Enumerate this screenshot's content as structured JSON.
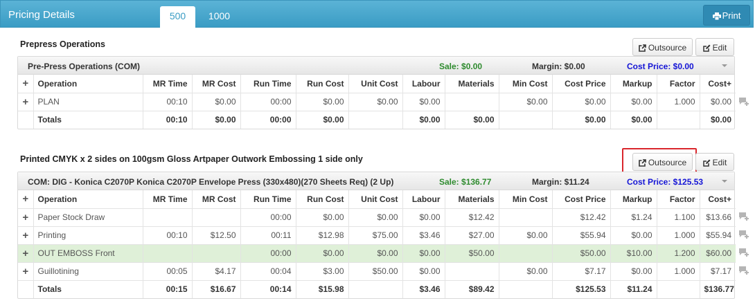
{
  "header": {
    "title": "Pricing Details",
    "tabs": [
      "500",
      "1000"
    ],
    "print_label": "Print"
  },
  "columns": [
    "Operation",
    "MR Time",
    "MR Cost",
    "Run Time",
    "Run Cost",
    "Unit Cost",
    "Labour",
    "Materials",
    "Min Cost",
    "Cost Price",
    "Markup",
    "Factor",
    "Cost+"
  ],
  "sections": [
    {
      "title": "Prepress Operations",
      "outsource_label": "Outsource",
      "edit_label": "Edit",
      "summary": {
        "name": "Pre-Press Operations (COM)",
        "sale": "Sale: $0.00",
        "margin": "Margin: $0.00",
        "cost_price": "Cost Price: $0.00"
      },
      "rows": [
        [
          "PLAN",
          "00:10",
          "$0.00",
          "00:00",
          "$0.00",
          "$0.00",
          "$0.00",
          "",
          "$0.00",
          "$0.00",
          "$0.00",
          "1.000",
          "$0.00"
        ]
      ],
      "totals": [
        "Totals",
        "00:10",
        "$0.00",
        "00:00",
        "$0.00",
        "",
        "$0.00",
        "$0.00",
        "",
        "$0.00",
        "$0.00",
        "",
        "$0.00"
      ]
    },
    {
      "title": "Printed CMYK x 2 sides on 100gsm Gloss Artpaper Outwork Embossing 1 side only",
      "outsource_label": "Outsource",
      "edit_label": "Edit",
      "summary": {
        "name": "COM: DIG - Konica C2070P Konica C2070P Envelope Press (330x480)(270 Sheets Req) (2 Up)",
        "sale": "Sale: $136.77",
        "margin": "Margin: $11.24",
        "cost_price": "Cost Price: $125.53"
      },
      "rows": [
        [
          "Paper Stock Draw",
          "",
          "",
          "00:00",
          "$0.00",
          "$0.00",
          "$0.00",
          "$12.42",
          "",
          "$12.42",
          "$1.24",
          "1.100",
          "$13.66"
        ],
        [
          "Printing",
          "00:10",
          "$12.50",
          "00:11",
          "$12.98",
          "$75.00",
          "$3.46",
          "$27.00",
          "$0.00",
          "$55.94",
          "$0.00",
          "1.000",
          "$55.94"
        ],
        [
          "OUT EMBOSS Front",
          "",
          "",
          "00:00",
          "$0.00",
          "$0.00",
          "$0.00",
          "$50.00",
          "",
          "$50.00",
          "$10.00",
          "1.200",
          "$60.00"
        ],
        [
          "Guillotining",
          "00:05",
          "$4.17",
          "00:04",
          "$3.00",
          "$50.00",
          "$0.00",
          "",
          "$0.00",
          "$7.17",
          "$0.00",
          "1.000",
          "$7.17"
        ]
      ],
      "totals": [
        "Totals",
        "00:15",
        "$16.67",
        "00:14",
        "$15.98",
        "",
        "$3.46",
        "$89.42",
        "",
        "$125.53",
        "$11.24",
        "",
        "$136.77"
      ]
    }
  ],
  "colors": {
    "header": "#3a9cc4",
    "sale": "#2e8b2e",
    "cost_price": "#1515d6",
    "highlight_row": "#dff0d8",
    "highlight_box": "#d9262c"
  }
}
